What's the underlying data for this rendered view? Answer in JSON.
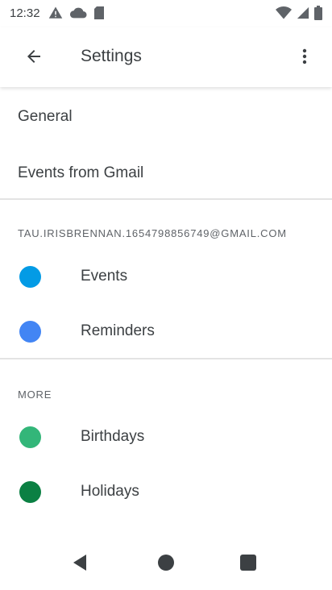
{
  "status_bar": {
    "time": "12:32",
    "left_icons": [
      "warning-icon",
      "cloud-icon",
      "sd-card-icon"
    ],
    "right_icons": [
      "wifi-icon",
      "cell-signal-icon",
      "battery-icon"
    ]
  },
  "app_bar": {
    "title": "Settings",
    "back_icon": "arrow-back-icon",
    "more_icon": "more-vert-icon"
  },
  "settings": {
    "general": "General",
    "events_from_gmail": "Events from Gmail"
  },
  "account_section": {
    "header": "TAU.IRISBRENNAN.1654798856749@GMAIL.COM",
    "calendars": [
      {
        "label": "Events",
        "color": "#039be5"
      },
      {
        "label": "Reminders",
        "color": "#4285f4"
      }
    ]
  },
  "more_section": {
    "header": "MORE",
    "calendars": [
      {
        "label": "Birthdays",
        "color": "#33b679"
      },
      {
        "label": "Holidays",
        "color": "#0b8043"
      }
    ]
  },
  "nav_bar": {
    "back": "nav-back-icon",
    "home": "nav-home-icon",
    "recents": "nav-recents-icon"
  }
}
